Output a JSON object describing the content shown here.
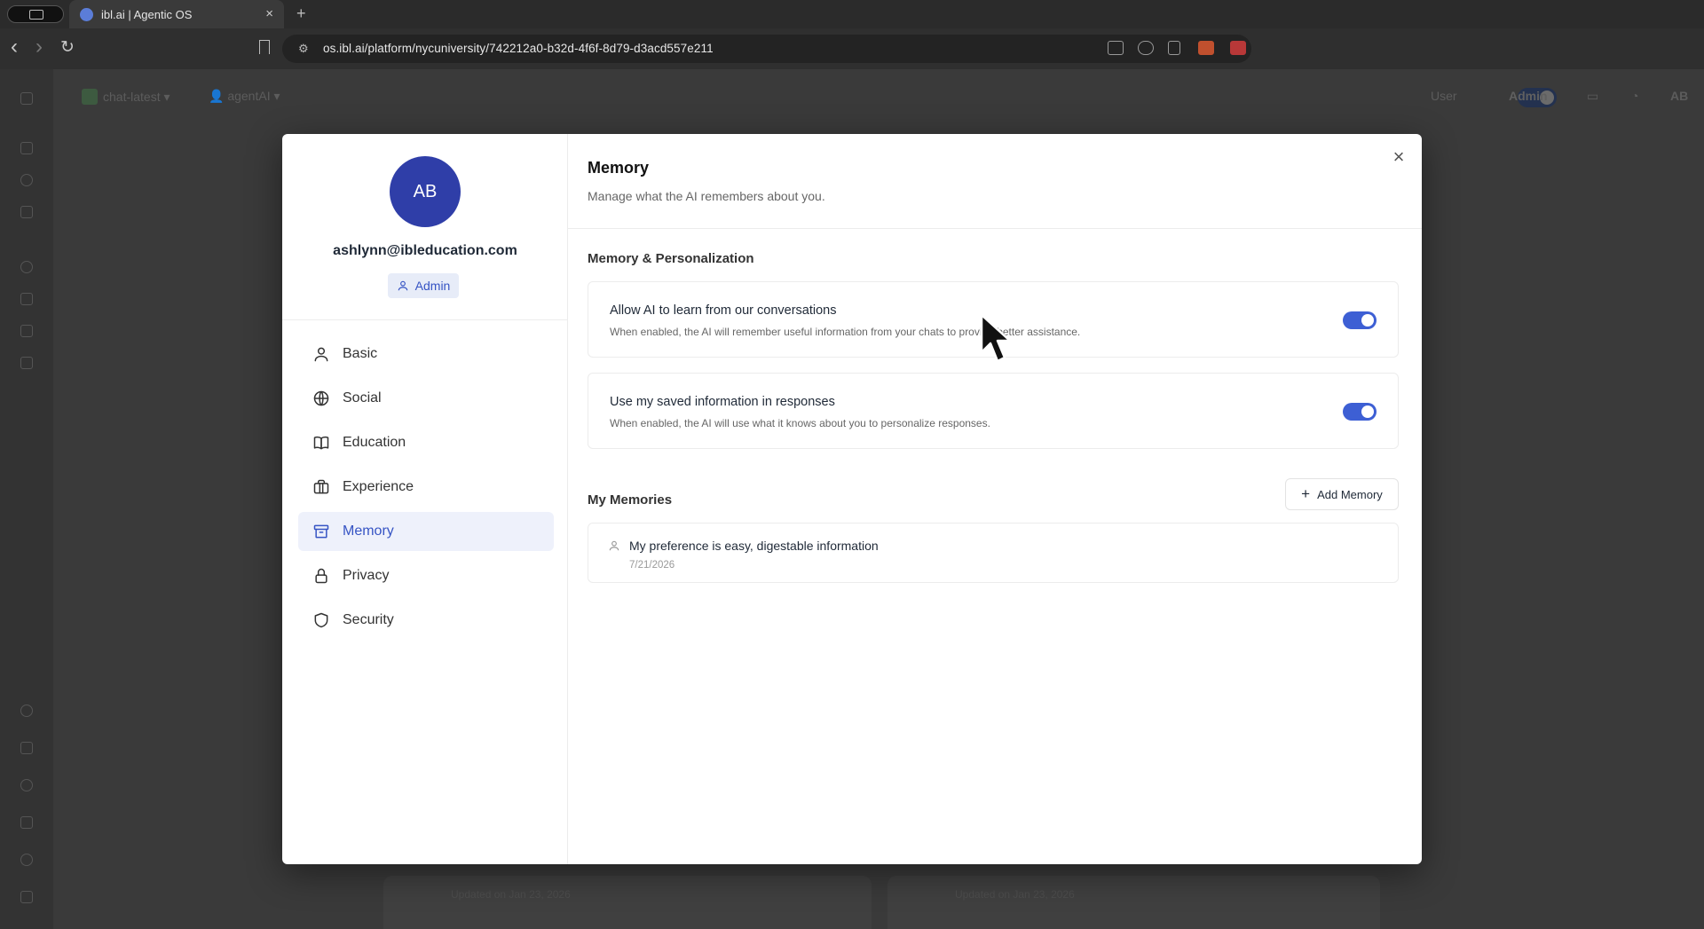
{
  "browser": {
    "tab_title": "ibl.ai | Agentic OS",
    "tab_close": "×",
    "new_tab": "+",
    "url": "os.ibl.ai/platform/nycuniversity/742212a0-b32d-4f6f-8d79-d3acd557e211",
    "back_glyph": "‹",
    "forward_glyph": "›",
    "reload_glyph": "↻",
    "site_info_glyph": "⚙"
  },
  "app": {
    "model_selector": "chat-latest",
    "agent_selector": "agentAI",
    "mode_user_label": "User",
    "mode_admin_label": "Admin",
    "user_initials": "AB",
    "bg_card_left_text": "Updated on Jan 23, 2026",
    "bg_card_right_text": "Updated on Jan 23, 2026"
  },
  "modal": {
    "close_glyph": "×",
    "profile": {
      "initials": "AB",
      "email": "ashlynn@ibleducation.com",
      "role": "Admin"
    },
    "nav": [
      {
        "label": "Basic",
        "icon": "user-icon"
      },
      {
        "label": "Social",
        "icon": "globe-icon"
      },
      {
        "label": "Education",
        "icon": "book-icon"
      },
      {
        "label": "Experience",
        "icon": "briefcase-icon"
      },
      {
        "label": "Memory",
        "icon": "archive-icon",
        "active": true
      },
      {
        "label": "Privacy",
        "icon": "lock-icon"
      },
      {
        "label": "Security",
        "icon": "shield-icon"
      }
    ],
    "section": {
      "title": "Memory",
      "subtitle": "Manage what the AI remembers about you.",
      "group_title": "Memory & Personalization",
      "settings": [
        {
          "label": "Allow AI to learn from our conversations",
          "description": "When enabled, the AI will remember useful information from your chats to provide better assistance.",
          "enabled": true
        },
        {
          "label": "Use my saved information in responses",
          "description": "When enabled, the AI will use what it knows about you to personalize responses.",
          "enabled": true
        }
      ],
      "memories_title": "My Memories",
      "add_memory_label": "Add Memory",
      "add_memory_glyph": "+",
      "memories": [
        {
          "text": "My preference is easy, digestable information",
          "date": "7/21/2026"
        }
      ]
    }
  },
  "colors": {
    "accent": "#3d5fd4",
    "avatar": "#2f3ea8",
    "active_nav_bg": "#eef1fb"
  }
}
